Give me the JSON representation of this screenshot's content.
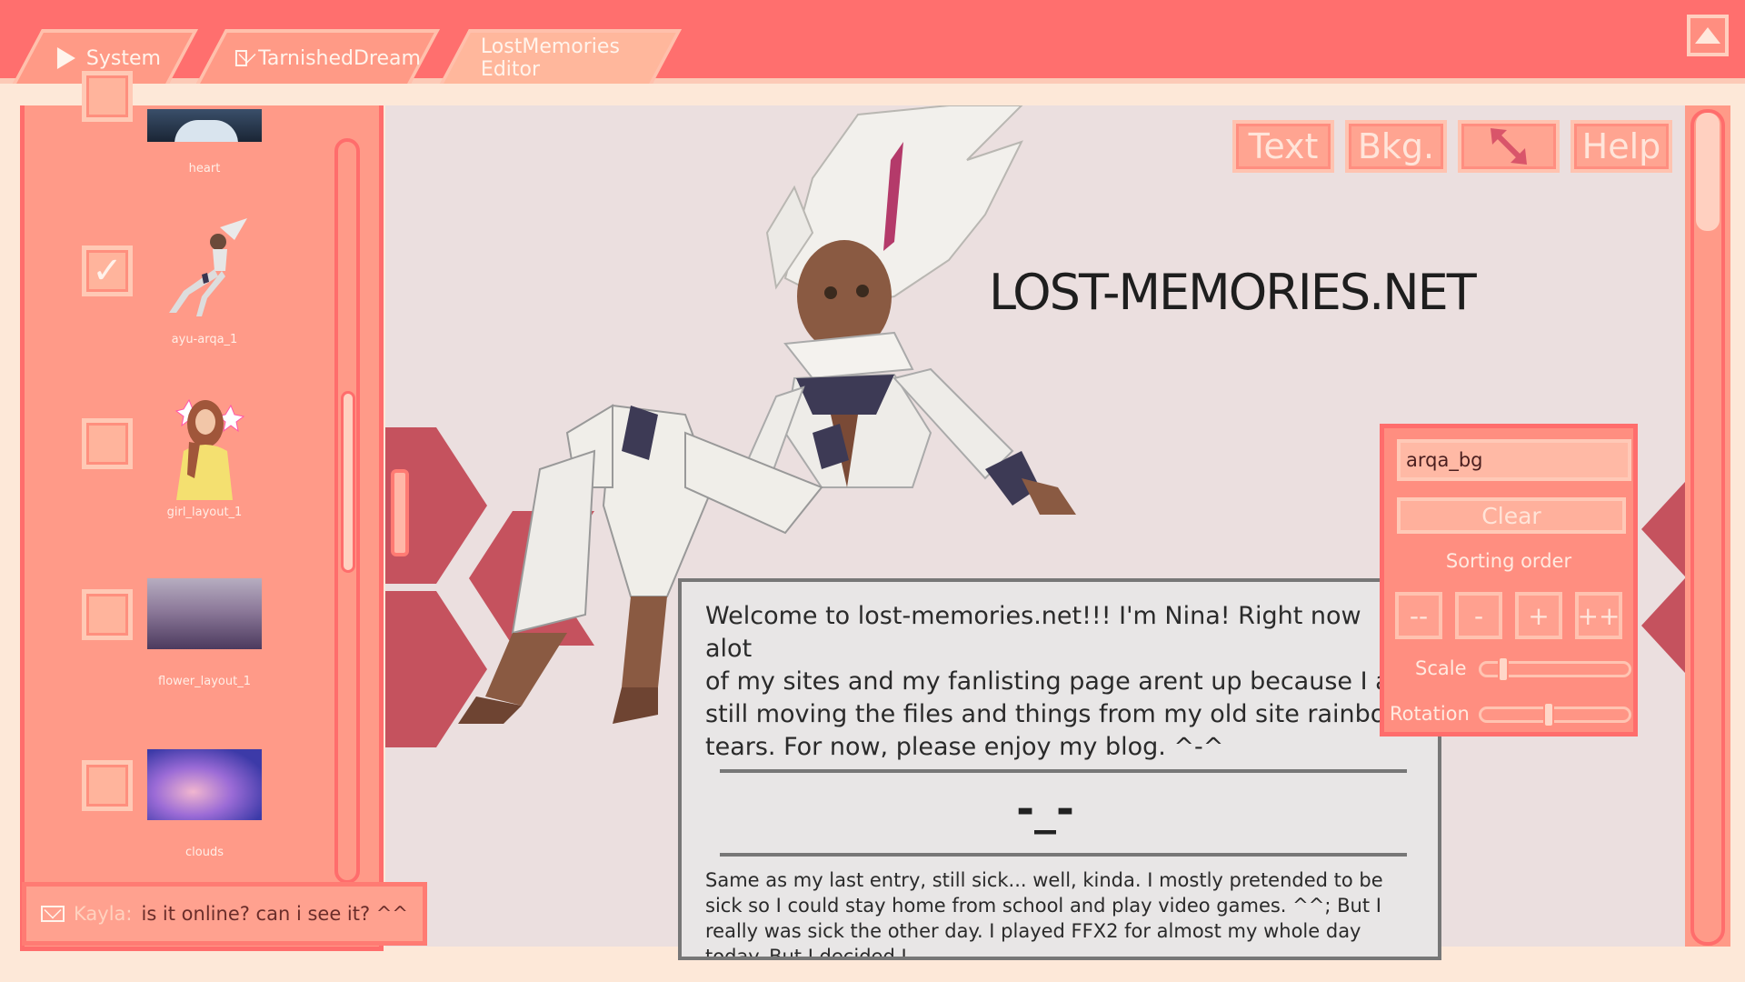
{
  "tabs": [
    {
      "label": "System",
      "icon": "play-icon"
    },
    {
      "label": "TarnishedDream",
      "icon": "mail-icon"
    },
    {
      "label": "LostMemories Editor",
      "icon": null
    }
  ],
  "toolbar": {
    "text_label": "Text",
    "bkg_label": "Bkg.",
    "resize_icon": "resize-arrows-icon",
    "help_label": "Help"
  },
  "assets": [
    {
      "caption": "heart",
      "checked": false
    },
    {
      "caption": "ayu-arqa_1",
      "checked": true
    },
    {
      "caption": "girl_layout_1",
      "checked": false
    },
    {
      "caption": "flower_layout_1",
      "checked": false
    },
    {
      "caption": "clouds",
      "checked": false
    }
  ],
  "site": {
    "title": "LOST-MEMORIES.NET"
  },
  "entry": {
    "welcome": "Welcome to lost-memories.net!!! I'm Nina! Right now alot\nof my sites and my fanlisting page arent up because I a\nstill moving the files and things from my old site rainbo\ntears. For now, please enjoy my blog. ^-^",
    "face": "-_-",
    "post": "Same as my last entry, still sick... well, kinda. I mostly pretended to be sick so I could stay home from school and play video games. ^^; But I really was sick the other day. I played FFX2 for almost my whole day today. But I decided I"
  },
  "properties": {
    "name_value": "arqa_bg",
    "clear_label": "Clear",
    "sorting_label": "Sorting order",
    "sort_buttons": [
      "--",
      "-",
      "+",
      "++"
    ],
    "scale_label": "Scale",
    "scale_value": 0.12,
    "rotation_label": "Rotation",
    "rotation_value": 0.45
  },
  "chat": {
    "sender": "Kayla:",
    "message": "is it online? can i see it? ^^"
  },
  "colors": {
    "topbar": "#ff6f6e",
    "panel": "#ff9a88",
    "canvas": "#ebdfdf",
    "chevron": "#c5525e"
  }
}
